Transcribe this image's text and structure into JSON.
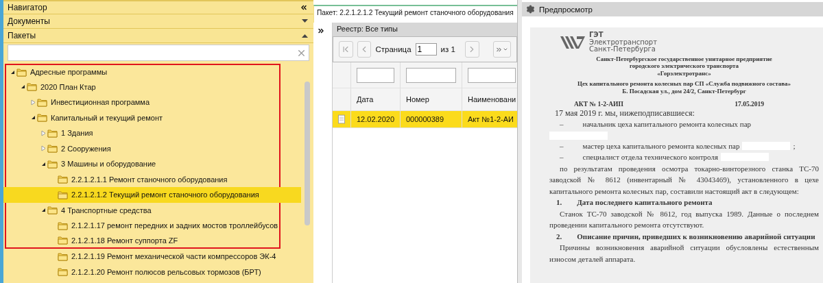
{
  "navigator": {
    "title": "Навигатор",
    "sections": [
      {
        "title": "Документы",
        "expanded": false
      },
      {
        "title": "Пакеты",
        "expanded": true
      }
    ]
  },
  "tree": [
    {
      "label": "Адресные программы",
      "kind": "branch",
      "expanded": true,
      "selected": false,
      "framed": true,
      "children": [
        {
          "label": "2020 План Ктар",
          "kind": "branch",
          "expanded": true,
          "selected": false,
          "framed": true,
          "children": [
            {
              "label": "Инвестиционная программа",
              "kind": "branch",
              "expanded": false,
              "selected": false,
              "framed": true
            },
            {
              "label": "Капитальный и текущий ремонт",
              "kind": "branch",
              "expanded": true,
              "selected": false,
              "framed": true,
              "children": [
                {
                  "label": "1 Здания",
                  "kind": "branch",
                  "expanded": false,
                  "selected": false,
                  "framed": true
                },
                {
                  "label": "2 Сооружения",
                  "kind": "branch",
                  "expanded": false,
                  "selected": false,
                  "framed": true
                },
                {
                  "label": "3 Машины и оборудование",
                  "kind": "branch",
                  "expanded": true,
                  "selected": false,
                  "framed": true,
                  "children": [
                    {
                      "label": "2.2.1.2.1.1 Ремонт станочного оборудования",
                      "kind": "leaf",
                      "selected": false,
                      "framed": true
                    },
                    {
                      "label": "2.2.1.2.1.2 Текущий ремонт станочного оборудования",
                      "kind": "leaf",
                      "selected": true,
                      "framed": true
                    }
                  ]
                },
                {
                  "label": "4 Транспортные средства",
                  "kind": "branch",
                  "expanded": true,
                  "selected": false,
                  "framed": true,
                  "children": [
                    {
                      "label": "2.1.2.1.17 ремонт передних и задних мостов троллейбусов",
                      "kind": "leaf",
                      "selected": false,
                      "framed": true
                    },
                    {
                      "label": "2.1.2.1.18 Ремонт суппорта ZF",
                      "kind": "leaf",
                      "selected": false,
                      "framed": true
                    },
                    {
                      "label": "2.1.2.1.19 Ремонт механической части компрессоров ЭК-4",
                      "kind": "leaf",
                      "selected": false,
                      "framed": false
                    },
                    {
                      "label": "2.1.2.1.20 Ремонт полюсов рельсовых тормозов (БРТ)",
                      "kind": "leaf",
                      "selected": false,
                      "framed": false
                    }
                  ]
                }
              ]
            }
          ]
        }
      ]
    }
  ],
  "package_panel": {
    "title": "Пакет: 2.2.1.2.1.2 Текущий ремонт станочного оборудования",
    "registry": {
      "title": "Реестр: Все типы",
      "pager": {
        "page_label": "Страница",
        "page": "1",
        "of_label": "из 1"
      },
      "columns": [
        "Дата",
        "Номер",
        "Наименовани"
      ],
      "rows": [
        {
          "date": "12.02.2020",
          "number": "000000389",
          "name": "Акт №1-2-АИ",
          "selected": true
        }
      ]
    }
  },
  "preview": {
    "title": "Предпросмотр",
    "document": {
      "logo": [
        "ГЭТ",
        "Электротранспорт",
        "Санкт-Петербурга"
      ],
      "header_lines": [
        "Санкт-Петербургское государственное унитарное предприятие",
        "городского электрического транспорта",
        "«Горэлектротранс»"
      ],
      "sub_lines": [
        "Цех капитального ремонта колесных пар СП «Служба подвижного состава»",
        "Б. Посадская ул., дом 24/2, Санкт-Петербург"
      ],
      "act_number": "АКТ № 1-2-АИП",
      "act_date": "17.05.2019",
      "paragraphs": [
        {
          "kind": "lead",
          "text": "17 мая 2019 г. мы, нижеподписавшиеся:"
        },
        {
          "kind": "dash_wrapped",
          "marker": "–",
          "text": "начальник цеха капитального ремонта колесных пар",
          "redacted": true
        },
        {
          "kind": "dash",
          "marker": "–",
          "text": "мастер цеха капитального ремонта колесных пар",
          "redacted": true,
          "suffix": ";"
        },
        {
          "kind": "dash",
          "marker": "–",
          "text": "специалист отдела технического контроля",
          "redacted": true
        },
        {
          "kind": "text",
          "text": "по результатам проведения осмотра токарно-винторезного станка ТС-70 заводской № 8612 (инвентарный № 43043469), установленного в цехе капитального ремонта колесных пар, составили настоящий акт в следующем:"
        },
        {
          "kind": "heading",
          "number": "1.",
          "text": "Дата последнего капитального ремонта"
        },
        {
          "kind": "text",
          "text": "Станок ТС-70 заводской № 8612, год выпуска 1989. Данные о последнем проведении капитального ремонта отсутствуют."
        },
        {
          "kind": "heading",
          "number": "2.",
          "text": "Описание причин, приведших к возникновению аварийной ситуации"
        },
        {
          "kind": "text",
          "text": "Причины возникновения аварийной ситуации обусловлены естественным износом деталей аппарата."
        }
      ]
    }
  }
}
